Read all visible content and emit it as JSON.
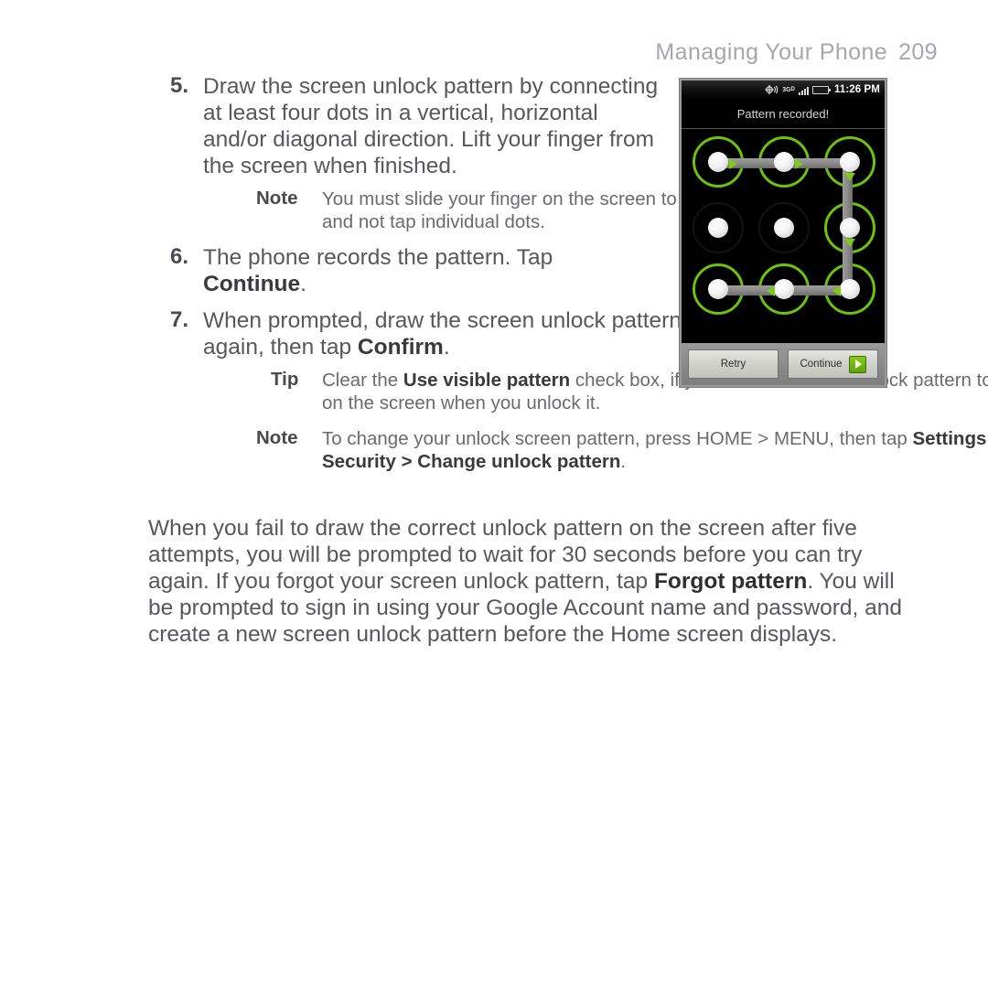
{
  "header": {
    "title": "Managing Your Phone",
    "page_number": "209"
  },
  "steps": [
    {
      "number": "5.",
      "text_parts": [
        {
          "t": "Draw the screen unlock pattern by connecting at least four dots in a vertical, horizontal and/or diagonal direction. Lift your finger from the screen when finished.",
          "bold": false
        }
      ],
      "text": "Draw the screen unlock pattern by connecting at least four dots in a vertical, horizontal and/or diagonal direction. Lift your finger from the screen when finished."
    },
    {
      "number": "6.",
      "text": "The phone records the pattern. Tap Continue."
    },
    {
      "number": "7.",
      "text": "When prompted, draw the screen unlock pattern again, then tap Confirm."
    }
  ],
  "callouts": {
    "note_step5": {
      "label": "Note",
      "text": "You must slide your finger on the screen to create the pattern and not tap individual dots."
    },
    "tip_step7": {
      "label": "Tip",
      "text": "Clear the Use visible pattern check box, if you do not want the unlock pattern to display on the screen when you unlock it."
    },
    "note_step7": {
      "label": "Note",
      "text": "To change your unlock screen pattern, press HOME > MENU, then tap Settings > Security > Change unlock pattern."
    }
  },
  "paragraph": {
    "text": "When you fail to draw the correct unlock pattern on the screen after five attempts, you will be prompted to wait for 30 seconds before you can try again. If you forgot your screen unlock pattern, tap Forgot pattern. You will be prompted to sign in using your Google Account name and password, and create a new screen unlock pattern before the Home screen displays."
  },
  "phone_screenshot": {
    "status_bar": {
      "time": "11:26 PM",
      "network_label": "3G",
      "network_sub": "D",
      "icons": [
        "gps-icon",
        "network-3g-icon",
        "signal-bars-icon",
        "battery-icon"
      ]
    },
    "message": "Pattern recorded!",
    "pattern": {
      "rows": 3,
      "columns": 3,
      "selected_cells": [
        0,
        1,
        2,
        5,
        6,
        7,
        8
      ],
      "unselected_cells": [
        3,
        4
      ],
      "path_order": [
        0,
        1,
        2,
        5,
        8,
        7,
        6
      ],
      "arrows": [
        {
          "cell": 0,
          "direction": "right"
        },
        {
          "cell": 1,
          "direction": "right"
        },
        {
          "cell": 2,
          "direction": "down"
        },
        {
          "cell": 5,
          "direction": "down"
        },
        {
          "cell": 8,
          "direction": "left"
        },
        {
          "cell": 7,
          "direction": "left"
        }
      ]
    },
    "buttons": {
      "retry_label": "Retry",
      "continue_label": "Continue"
    },
    "colors": {
      "selected_ring": "#6dc20a",
      "arrow_green": "#7ccb14",
      "screen_background": "#000000",
      "button_bar": "#8b8b8b"
    }
  }
}
